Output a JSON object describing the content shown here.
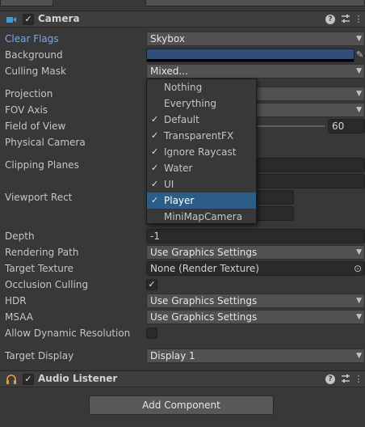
{
  "camera": {
    "title": "Camera",
    "enabled": true,
    "rows": [
      {
        "label": "Clear Flags",
        "value": "Skybox",
        "kind": "dropdown"
      },
      {
        "label": "Background",
        "value": "",
        "kind": "color",
        "color": "#314d79"
      },
      {
        "label": "Culling Mask",
        "value": "Mixed...",
        "kind": "dropdown"
      },
      {
        "label": "Projection",
        "value": "",
        "kind": "dropdown"
      },
      {
        "label": "FOV Axis",
        "value": "",
        "kind": "dropdown"
      },
      {
        "label": "Field of View",
        "value": "60",
        "kind": "slider"
      },
      {
        "label": "Physical Camera",
        "value": "",
        "kind": "checkbox"
      },
      {
        "label": "Clipping Planes",
        "value": "",
        "kind": "fields"
      },
      {
        "label": "Viewport Rect",
        "value": "",
        "kind": "fields"
      },
      {
        "label": "Depth",
        "value": "-1",
        "kind": "number"
      },
      {
        "label": "Rendering Path",
        "value": "Use Graphics Settings",
        "kind": "dropdown"
      },
      {
        "label": "Target Texture",
        "value": "None (Render Texture)",
        "kind": "object"
      },
      {
        "label": "Occlusion Culling",
        "value": true,
        "kind": "checkbox"
      },
      {
        "label": "HDR",
        "value": "Use Graphics Settings",
        "kind": "dropdown"
      },
      {
        "label": "MSAA",
        "value": "Use Graphics Settings",
        "kind": "dropdown"
      },
      {
        "label": "Allow Dynamic Resolution",
        "value": false,
        "kind": "checkbox"
      },
      {
        "label": "Target Display",
        "value": "Display 1",
        "kind": "dropdown"
      }
    ]
  },
  "culling_mask_popup": {
    "items": [
      {
        "label": "Nothing",
        "checked": false,
        "selected": false
      },
      {
        "label": "Everything",
        "checked": false,
        "selected": false
      },
      {
        "label": "Default",
        "checked": true,
        "selected": false
      },
      {
        "label": "TransparentFX",
        "checked": true,
        "selected": false
      },
      {
        "label": "Ignore Raycast",
        "checked": true,
        "selected": false
      },
      {
        "label": "Water",
        "checked": true,
        "selected": false
      },
      {
        "label": "UI",
        "checked": true,
        "selected": false
      },
      {
        "label": "Player",
        "checked": true,
        "selected": true
      },
      {
        "label": "MiniMapCamera",
        "checked": false,
        "selected": false
      }
    ]
  },
  "audio_listener": {
    "title": "Audio Listener",
    "enabled": true
  },
  "add_component_label": "Add Component",
  "icons": {
    "check": "✓",
    "help": "?",
    "settings": "⇅",
    "menu": "⋮",
    "arrow": "▼",
    "picker": "✎",
    "object": "⊙"
  },
  "colors": {
    "accent_label": "#7ba7e0",
    "selection": "#2c5d87",
    "camera_icon": "#3c9ae0",
    "audio_icon": "#e0a33c"
  }
}
